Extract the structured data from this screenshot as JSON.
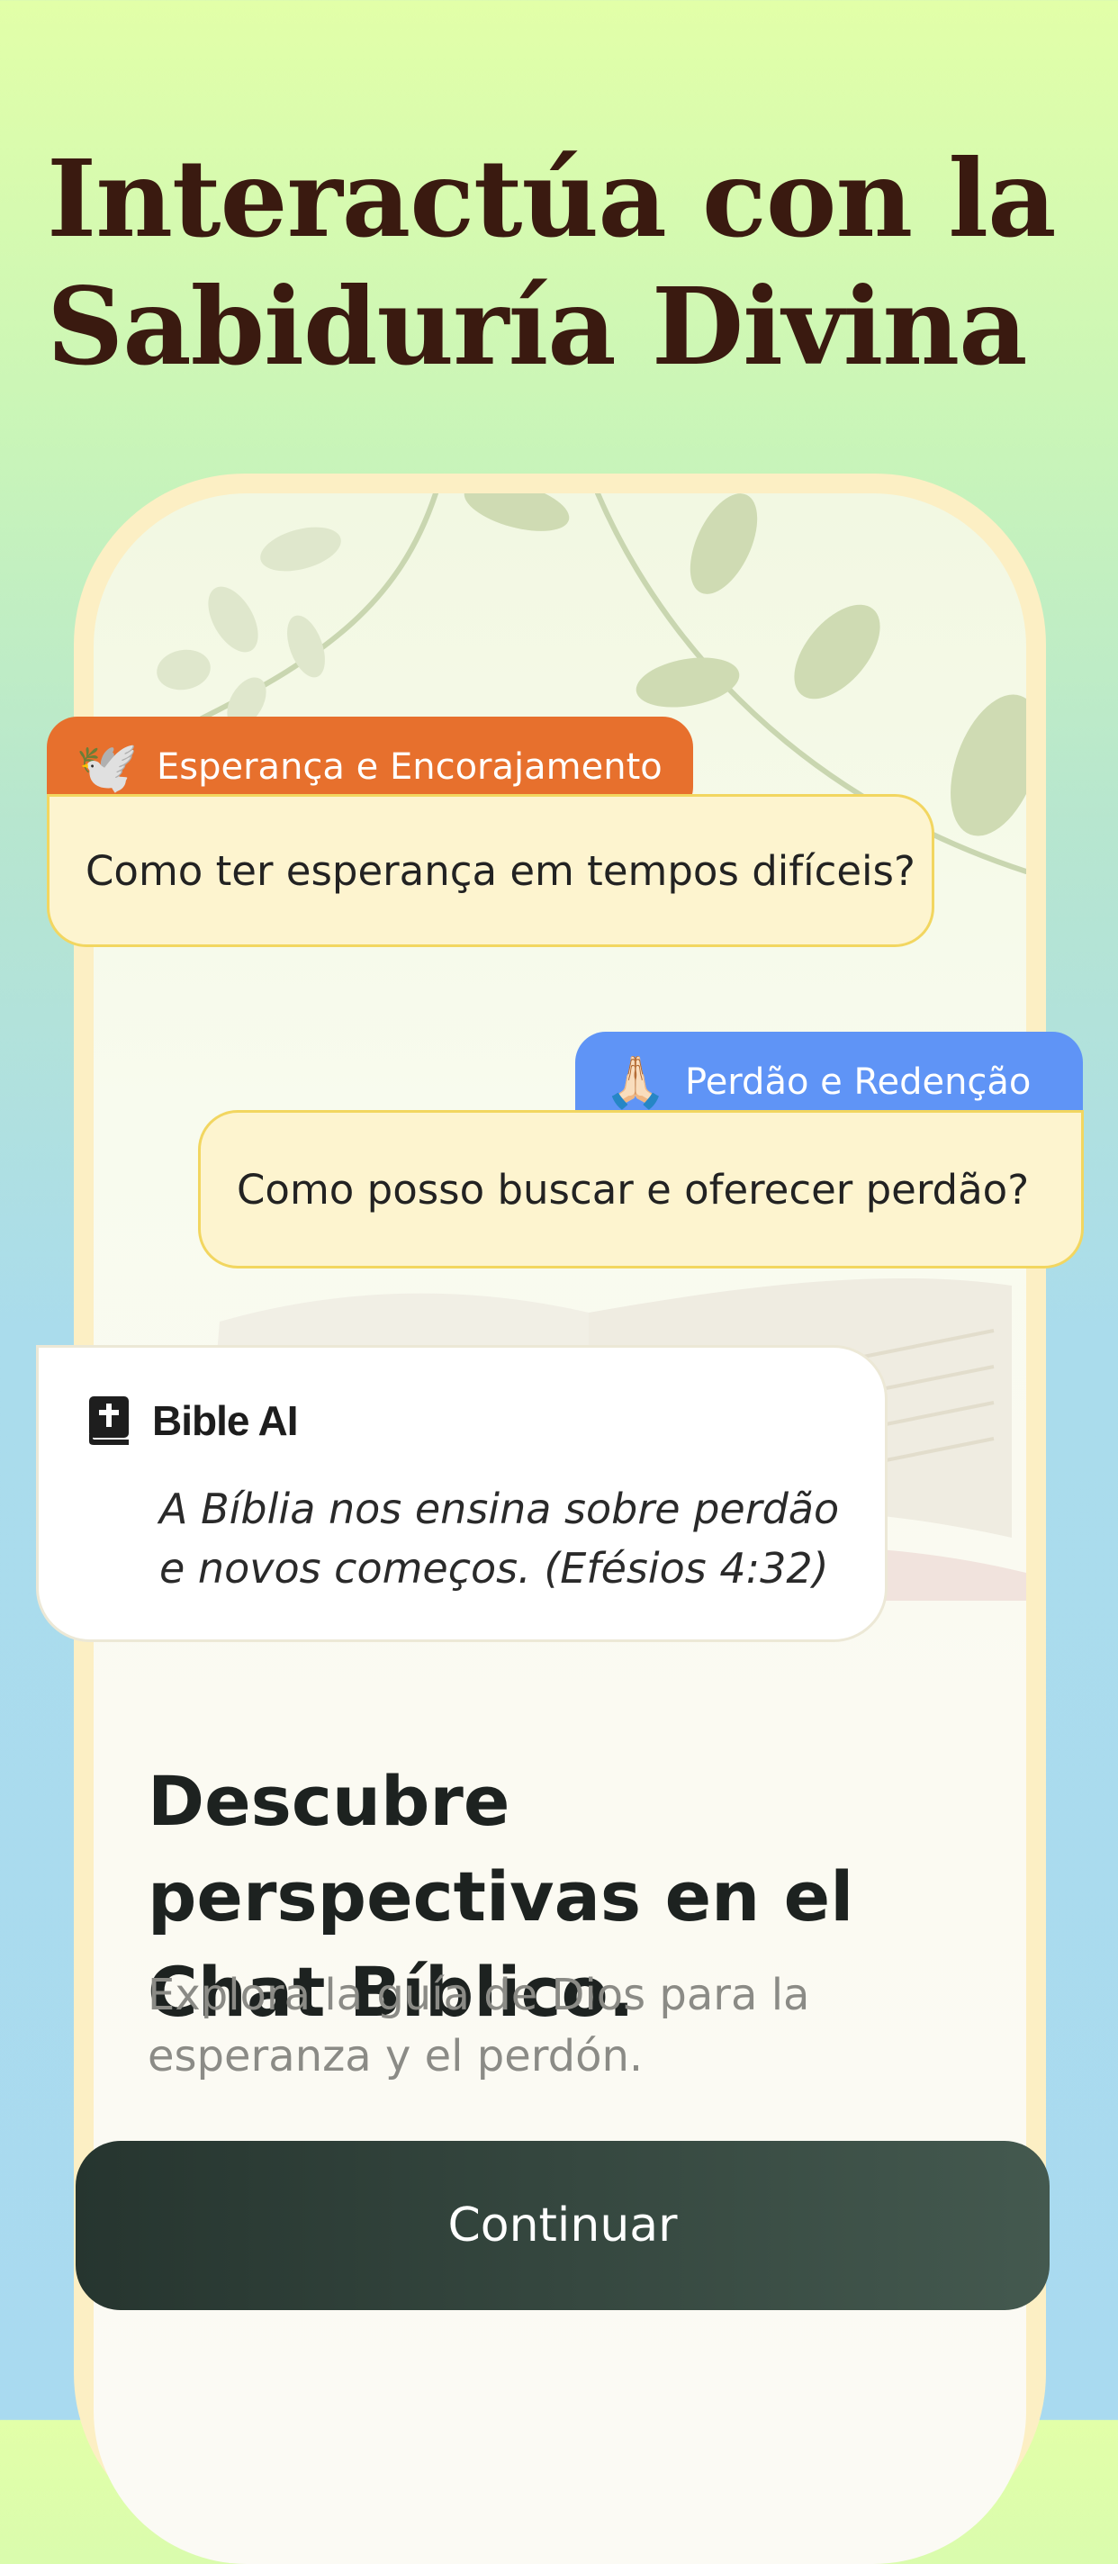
{
  "header": {
    "title_line1": "Interactúa con la",
    "title_line2": "Sabiduría Divina"
  },
  "chat": {
    "message1": {
      "tag_icon": "dove-icon",
      "tag_emoji": "🕊️",
      "tag_label": "Esperança e Encorajamento",
      "tag_color": "#e7702d",
      "text": "Como ter esperança em tempos difíceis?"
    },
    "message2": {
      "tag_icon": "praying-hands-icon",
      "tag_emoji": "🙏🏻",
      "tag_label": "Perdão e Redenção",
      "tag_color": "#5f94f6",
      "text": "Como posso buscar e oferecer perdão?"
    },
    "ai_reply": {
      "icon": "bible-icon",
      "name": "Bible AI",
      "text": "A Bíblia nos ensina sobre perdão e novos começos. (Efésios 4:32)"
    }
  },
  "content": {
    "heading": "Descubre perspectivas en el Chat Bíblico.",
    "subtext": "Explora la guía de Dios para la esperanza y el perdón."
  },
  "actions": {
    "continue_label": "Continuar"
  },
  "colors": {
    "headline": "#3a1a10",
    "bubble_bg": "#fdf4cf",
    "bubble_border": "#f2d660",
    "button_dark": "#26352f"
  }
}
